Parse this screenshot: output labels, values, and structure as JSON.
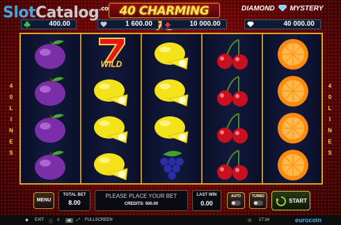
{
  "header": {
    "watermark": {
      "slot": "Slot",
      "catalog": "Catalog",
      "com": ".com"
    },
    "game_title": "40 CHARMING 7's",
    "logo_right": {
      "left": "DIAMOND",
      "right": "MYSTERY"
    }
  },
  "jackpots": [
    {
      "icon": "club-icon",
      "value": "400.00",
      "color": "#37c04a"
    },
    {
      "icon": "heart-icon",
      "value": "1 600.00",
      "color": "#c8c8c8"
    },
    {
      "icon": "spade-icon",
      "value": "10 000.00",
      "color": "#e0304a"
    },
    {
      "icon": "diamond-icon",
      "value": "40 000.00",
      "color": "#ffffff"
    }
  ],
  "lines_left": [
    "4",
    "0",
    "L",
    "I",
    "N",
    "E",
    "S"
  ],
  "lines_right": [
    "4",
    "0",
    "L",
    "I",
    "N",
    "E",
    "S"
  ],
  "reels": [
    [
      "plum",
      "plum",
      "plum",
      "plum"
    ],
    [
      "seven-wild",
      "lemon",
      "lemon",
      "lemon"
    ],
    [
      "lemon",
      "lemon",
      "lemon",
      "grapes"
    ],
    [
      "cherry",
      "cherry",
      "cherry",
      "cherry"
    ],
    [
      "orange",
      "orange",
      "orange",
      "orange"
    ]
  ],
  "wild_label": "WILD",
  "controls": {
    "menu": "MENU",
    "total_bet_label": "TOTAL BET",
    "total_bet_value": "8.00",
    "message": "PLEASE PLACE YOUR BET",
    "credits_label": "CREDITS:",
    "credits_value": "500.00",
    "last_win_label": "LAST WIN",
    "last_win_value": "0.00",
    "auto": "AUTO",
    "turbo": "TURBO",
    "start": "START"
  },
  "footer": {
    "exit": "EXIT",
    "fullscreen": "FULLSCREEN",
    "time": "17:14",
    "brand": "eurocoin"
  }
}
